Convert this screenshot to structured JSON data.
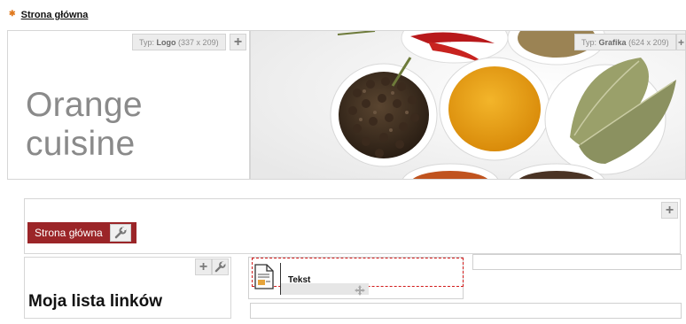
{
  "breadcrumb": {
    "label": "Strona główna"
  },
  "logo_slot": {
    "type_prefix": "Typ:",
    "type_name": "Logo",
    "type_size": "(337 x 209)",
    "logo_text": "Orange cuisine"
  },
  "graphic_slot": {
    "type_prefix": "Typ:",
    "type_name": "Grafika",
    "type_size": "(624 x 209)"
  },
  "menu": {
    "button_label": "Strona główna"
  },
  "links_box": {
    "title": "Moja lista linków"
  },
  "text_widget": {
    "label": "Tekst"
  },
  "colors": {
    "accent": "#9b2528",
    "breadcrumb_marker": "#e07a1f",
    "drop_outline": "#d11b1b"
  },
  "icons": [
    "plus-icon",
    "wrench-icon",
    "document-icon",
    "move-icon"
  ]
}
